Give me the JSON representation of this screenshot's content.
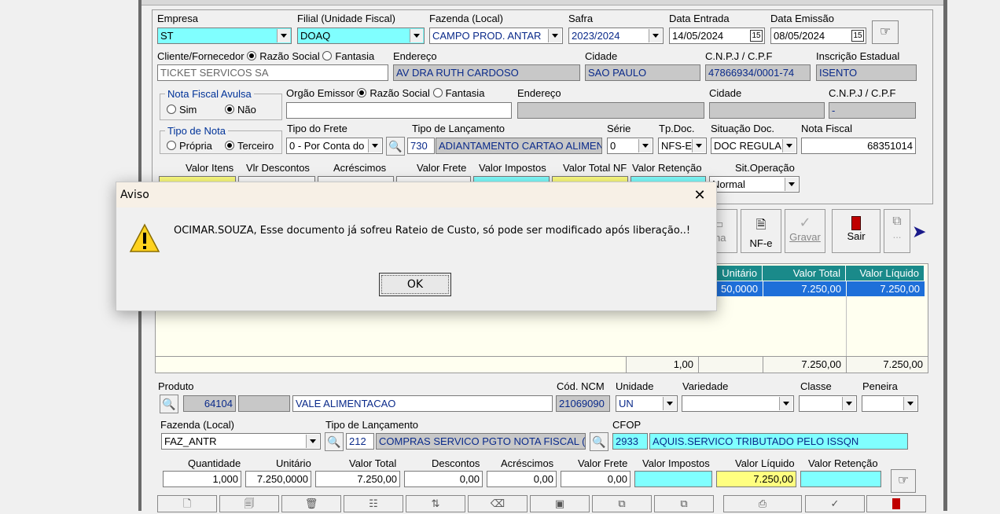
{
  "header": {
    "empresa": {
      "label": "Empresa",
      "value": "ST"
    },
    "filial": {
      "label": "Filial (Unidade Fiscal)",
      "value": "DOAQ"
    },
    "fazenda": {
      "label": "Fazenda (Local)",
      "value": "CAMPO PROD.  ANTAR"
    },
    "safra": {
      "label": "Safra",
      "value": "2023/2024"
    },
    "data_entrada": {
      "label": "Data Entrada",
      "value": "14/05/2024"
    },
    "data_emissao": {
      "label": "Data Emissão",
      "value": "08/05/2024"
    },
    "calendar_glyph": "15"
  },
  "cliente": {
    "label": "Cliente/Fornecedor",
    "razao_label": "Razão Social",
    "fantasia_label": "Fantasia",
    "value": "TICKET SERVICOS SA",
    "endereco_label": "Endereço",
    "endereco": "AV DRA RUTH CARDOSO",
    "cidade_label": "Cidade",
    "cidade": "SAO PAULO",
    "cnpj_label": "C.N.P.J / C.P.F",
    "cnpj": "47866934/0001-74",
    "ie_label": "Inscrição Estadual",
    "ie": "ISENTO"
  },
  "avulsa": {
    "title": "Nota Fiscal Avulsa",
    "sim": "Sim",
    "nao": "Não",
    "orgao_label": "Orgão Emissor",
    "razao_label": "Razão Social",
    "fantasia_label": "Fantasia",
    "endereco_label": "Endereço",
    "cidade_label": "Cidade",
    "cnpj_label": "C.N.P.J / C.P.F",
    "cnpj_value": "-"
  },
  "tipo_nota": {
    "title": "Tipo de Nota",
    "propria": "Própria",
    "terceiro": "Terceiro",
    "frete_label": "Tipo do Frete",
    "frete_value": "0 - Por Conta do",
    "lanc_label": "Tipo de Lançamento",
    "lanc_code": "730",
    "lanc_desc": "ADIANTAMENTO CARTAO ALIMEN",
    "serie_label": "Série",
    "serie_value": "0",
    "tpdoc_label": "Tp.Doc.",
    "tpdoc_value": "NFS-E",
    "situacao_label": "Situação Doc.",
    "situacao_value": "DOC REGULA",
    "nf_label": "Nota Fiscal",
    "nf_value": "68351014"
  },
  "valores": {
    "itens": "Valor Itens",
    "descontos": "Vlr Descontos",
    "acrescimos": "Acréscimos",
    "frete": "Valor Frete",
    "impostos": "Valor Impostos",
    "total_nf": "Valor Total NF",
    "retencao": "Valor Retenção",
    "sit_operacao_label": "Sit.Operação",
    "sit_operacao_value": "Normal"
  },
  "toolbar": {
    "ficha": "cha",
    "nfe": "NF-e",
    "gravar": "Gravar",
    "sair": "Sair",
    "more": "..."
  },
  "grid": {
    "headers": [
      "Unitário",
      "Valor Total",
      "Valor Líquido"
    ],
    "row": {
      "unitario": "50,0000",
      "total": "7.250,00",
      "liquido": "7.250,00"
    },
    "totals": {
      "qty": "1,00",
      "total": "7.250,00",
      "liquido": "7.250,00"
    }
  },
  "produto": {
    "label": "Produto",
    "code": "64104",
    "desc": "VALE ALIMENTACAO",
    "ncm_label": "Cód. NCM",
    "ncm": "21069090",
    "unidade_label": "Unidade",
    "unidade": "UN",
    "variedade_label": "Variedade",
    "classe_label": "Classe",
    "peneira_label": "Peneira"
  },
  "item_fazenda": {
    "label": "Fazenda (Local)",
    "value": "FAZ_ANTR",
    "lanc_label": "Tipo de Lançamento",
    "lanc_code": "212",
    "lanc_desc": "COMPRAS SERVICO PGTO NOTA FISCAL (I",
    "cfop_label": "CFOP",
    "cfop_code": "2933",
    "cfop_desc": "AQUIS.SERVICO TRIBUTADO PELO ISSQN"
  },
  "item_valores": {
    "quantidade_label": "Quantidade",
    "quantidade": "1,000",
    "unitario_label": "Unitário",
    "unitario": "7.250,0000",
    "total_label": "Valor Total",
    "total": "7.250,00",
    "descontos_label": "Descontos",
    "descontos": "0,00",
    "acrescimos_label": "Acréscimos",
    "acrescimos": "0,00",
    "frete_label": "Valor Frete",
    "frete": "0,00",
    "impostos_label": "Valor Impostos",
    "impostos": "",
    "liquido_label": "Valor Líquido",
    "liquido": "7.250,00",
    "retencao_label": "Valor Retenção",
    "retencao": ""
  },
  "dialog": {
    "title": "Aviso",
    "message": "OCIMAR.SOUZA, Esse documento já sofreu Rateio de Custo, só pode ser modificado após liberação..!",
    "ok": "OK"
  },
  "colors": {
    "cyan": "#80ffff",
    "gray": "#c8c8c8",
    "yellow": "#ffff80",
    "grid_header": "#1a8a8a",
    "selection": "#1e6fd9"
  },
  "icons": [
    "dropdown-arrow-icon",
    "calendar-icon",
    "pointing-hand-icon",
    "magnifier-icon",
    "warning-icon",
    "close-icon",
    "document-icon",
    "check-icon",
    "exit-door-icon",
    "copy-icon",
    "arrow-right-icon"
  ]
}
